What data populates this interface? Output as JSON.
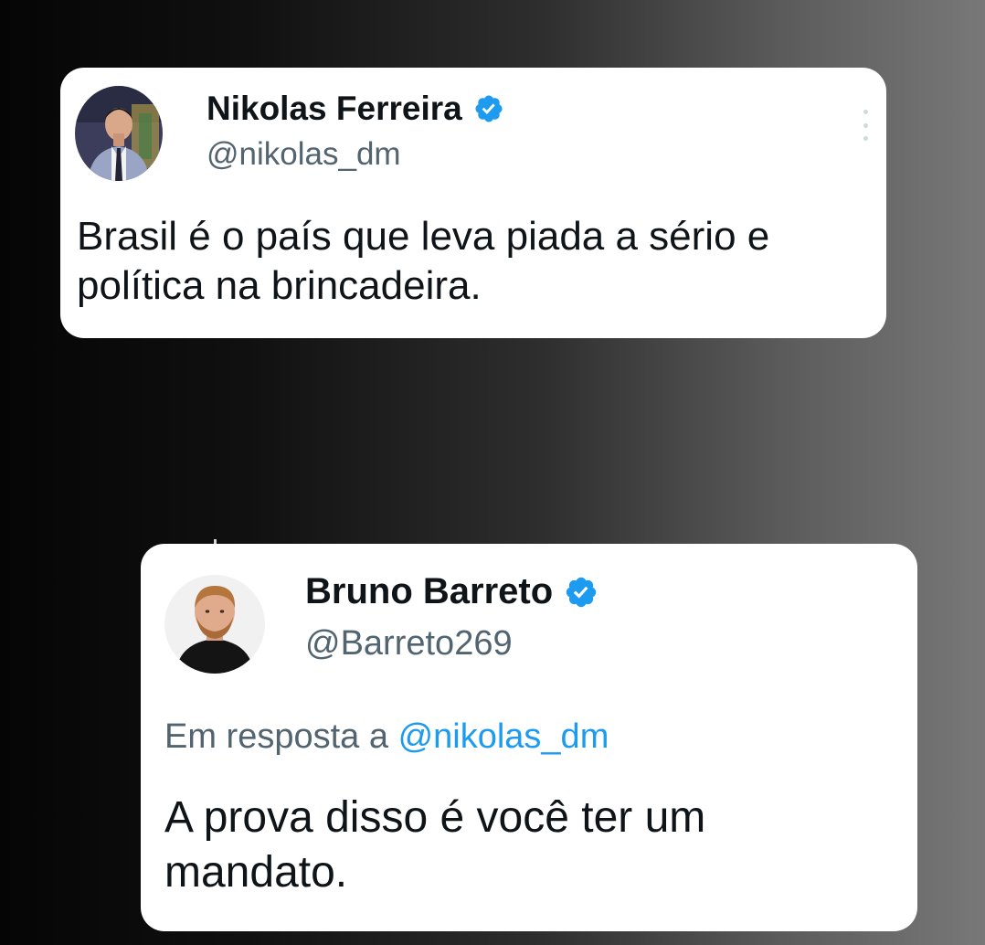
{
  "tweets": [
    {
      "author_name": "Nikolas Ferreira",
      "handle": "@nikolas_dm",
      "verified": true,
      "text": "Brasil é o país que leva piada a sério e política na brincadeira.",
      "avatar_icon": "person-avatar-suit"
    },
    {
      "author_name": "Bruno Barreto",
      "handle": "@Barreto269",
      "verified": true,
      "reply_prefix": "Em resposta a",
      "reply_mention": "@nikolas_dm",
      "text": "A prova disso é você ter um mandato.",
      "avatar_icon": "person-avatar-beard"
    }
  ],
  "colors": {
    "verified_badge": "#1d9bf0",
    "mention": "#1d9bf0",
    "handle": "#536471",
    "text": "#0f1419",
    "card": "#ffffff"
  },
  "icons": {
    "verified": "verified-badge-icon",
    "more": "more-options-icon"
  }
}
